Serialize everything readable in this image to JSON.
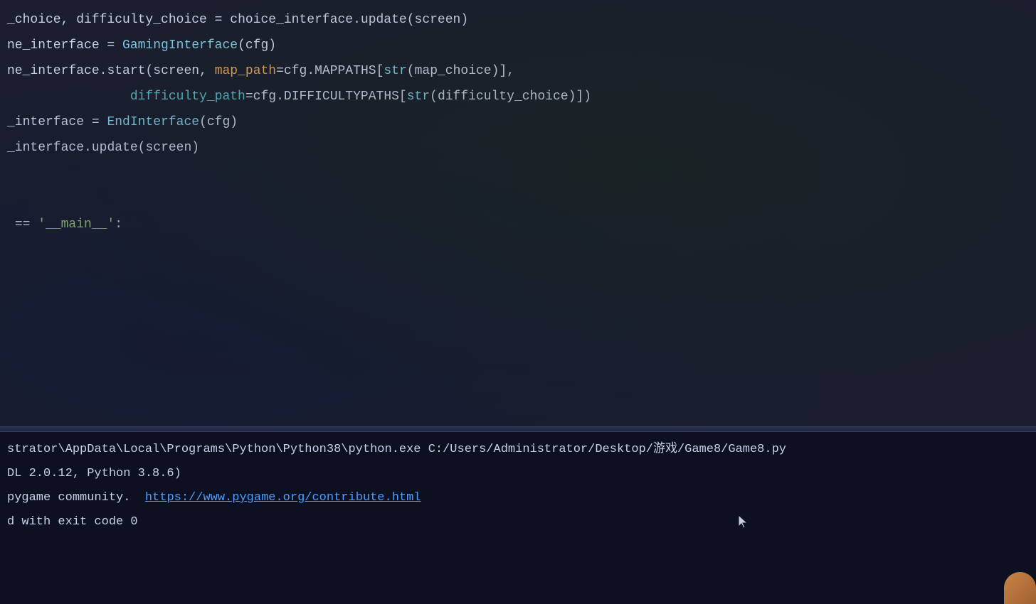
{
  "editor": {
    "background": "#1a1e2e",
    "lines": [
      {
        "id": "line1",
        "content": "_choice, difficulty_choice = choice_interface.update(screen)"
      },
      {
        "id": "line2",
        "content": "ne_interface = GamingInterface(cfg)"
      },
      {
        "id": "line3",
        "content": "ne_interface.start(screen, map_path=cfg.MAPPATHS[str(map_choice)],"
      },
      {
        "id": "line4",
        "content": "                difficulty_path=cfg.DIFFICULTYPATHS[str(difficulty_choice)])"
      },
      {
        "id": "line5",
        "content": "_interface = EndInterface(cfg)"
      },
      {
        "id": "line6",
        "content": "_interface.update(screen)"
      },
      {
        "id": "line7",
        "content": ""
      },
      {
        "id": "line8",
        "content": ""
      },
      {
        "id": "line9",
        "content": " == '__main__':"
      }
    ]
  },
  "terminal": {
    "lines": [
      {
        "id": "term1",
        "content": "strator\\AppData\\Local\\Programs\\Python\\Python38\\python.exe C:/Users/Administrator/Desktop/游戏/Game8/Game8.py"
      },
      {
        "id": "term2",
        "content": "DL 2.0.12, Python 3.8.6)"
      },
      {
        "id": "term3",
        "content": "pygame community.  ",
        "link": "https://www.pygame.org/contribute.html"
      },
      {
        "id": "term4",
        "content": ""
      },
      {
        "id": "term5",
        "content": "d with exit code 0"
      }
    ]
  }
}
